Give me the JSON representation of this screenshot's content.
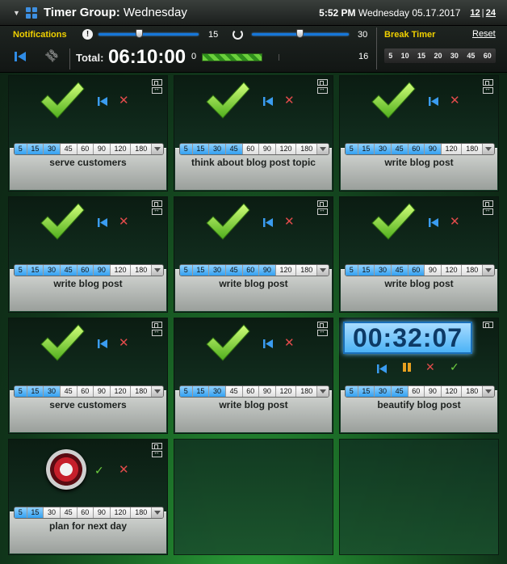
{
  "titlebar": {
    "app_name": "Timer Group:",
    "group_name": "Wednesday",
    "time": "5:52 PM",
    "date": "Wednesday 05.17.2017",
    "hour_12": "12",
    "separator": "|",
    "hour_24": "24"
  },
  "header": {
    "notifications_label": "Notifications",
    "alert_icon": "!",
    "slider1_value": "15",
    "slider1_level": 0.4,
    "slider2_value": "30",
    "slider2_level": 0.49,
    "break_timer_label": "Break Timer",
    "reset_label": "Reset",
    "break_options": [
      "5",
      "10",
      "15",
      "20",
      "30",
      "45",
      "60"
    ],
    "total_label": "Total:",
    "total_value": "06:10:00",
    "progress_min": "0",
    "progress_max": "16",
    "progress_fraction": 0.36
  },
  "chip_options": [
    "5",
    "15",
    "30",
    "45",
    "60",
    "90",
    "120",
    "180"
  ],
  "cards": [
    {
      "name": "serve customers",
      "state": "done",
      "selected": 2
    },
    {
      "name": "think about blog post topic",
      "state": "done",
      "selected": 3
    },
    {
      "name": "write blog post",
      "state": "done",
      "selected": 5
    },
    {
      "name": "write blog post",
      "state": "done",
      "selected": 5
    },
    {
      "name": "write blog post",
      "state": "done",
      "selected": 5
    },
    {
      "name": "write blog post",
      "state": "done",
      "selected": 4
    },
    {
      "name": "serve customers",
      "state": "done",
      "selected": 2
    },
    {
      "name": "write blog post",
      "state": "done",
      "selected": 2
    },
    {
      "name": "beautify blog post",
      "state": "running",
      "selected": 3,
      "time": "00:32:07"
    },
    {
      "name": "plan for next day",
      "state": "pending",
      "selected": 1
    }
  ],
  "colors": {
    "accent_yellow": "#f0d000",
    "chip_selected": "#33a0f0",
    "check_green": "#7dd43a",
    "delete_red": "#e24b4b",
    "pause_orange": "#e8a020"
  },
  "icons": {
    "collapse": "triangle-down-icon",
    "app": "grid-icon",
    "done": "checkmark-icon",
    "reset": "skip-back-icon",
    "delete": "x-icon",
    "pause": "pause-icon",
    "pending": "target-icon",
    "window": "window-icon",
    "swap": "swap-arrows-icon",
    "link": "link-icon",
    "repeat": "repeat-icon",
    "info": "info-icon"
  }
}
